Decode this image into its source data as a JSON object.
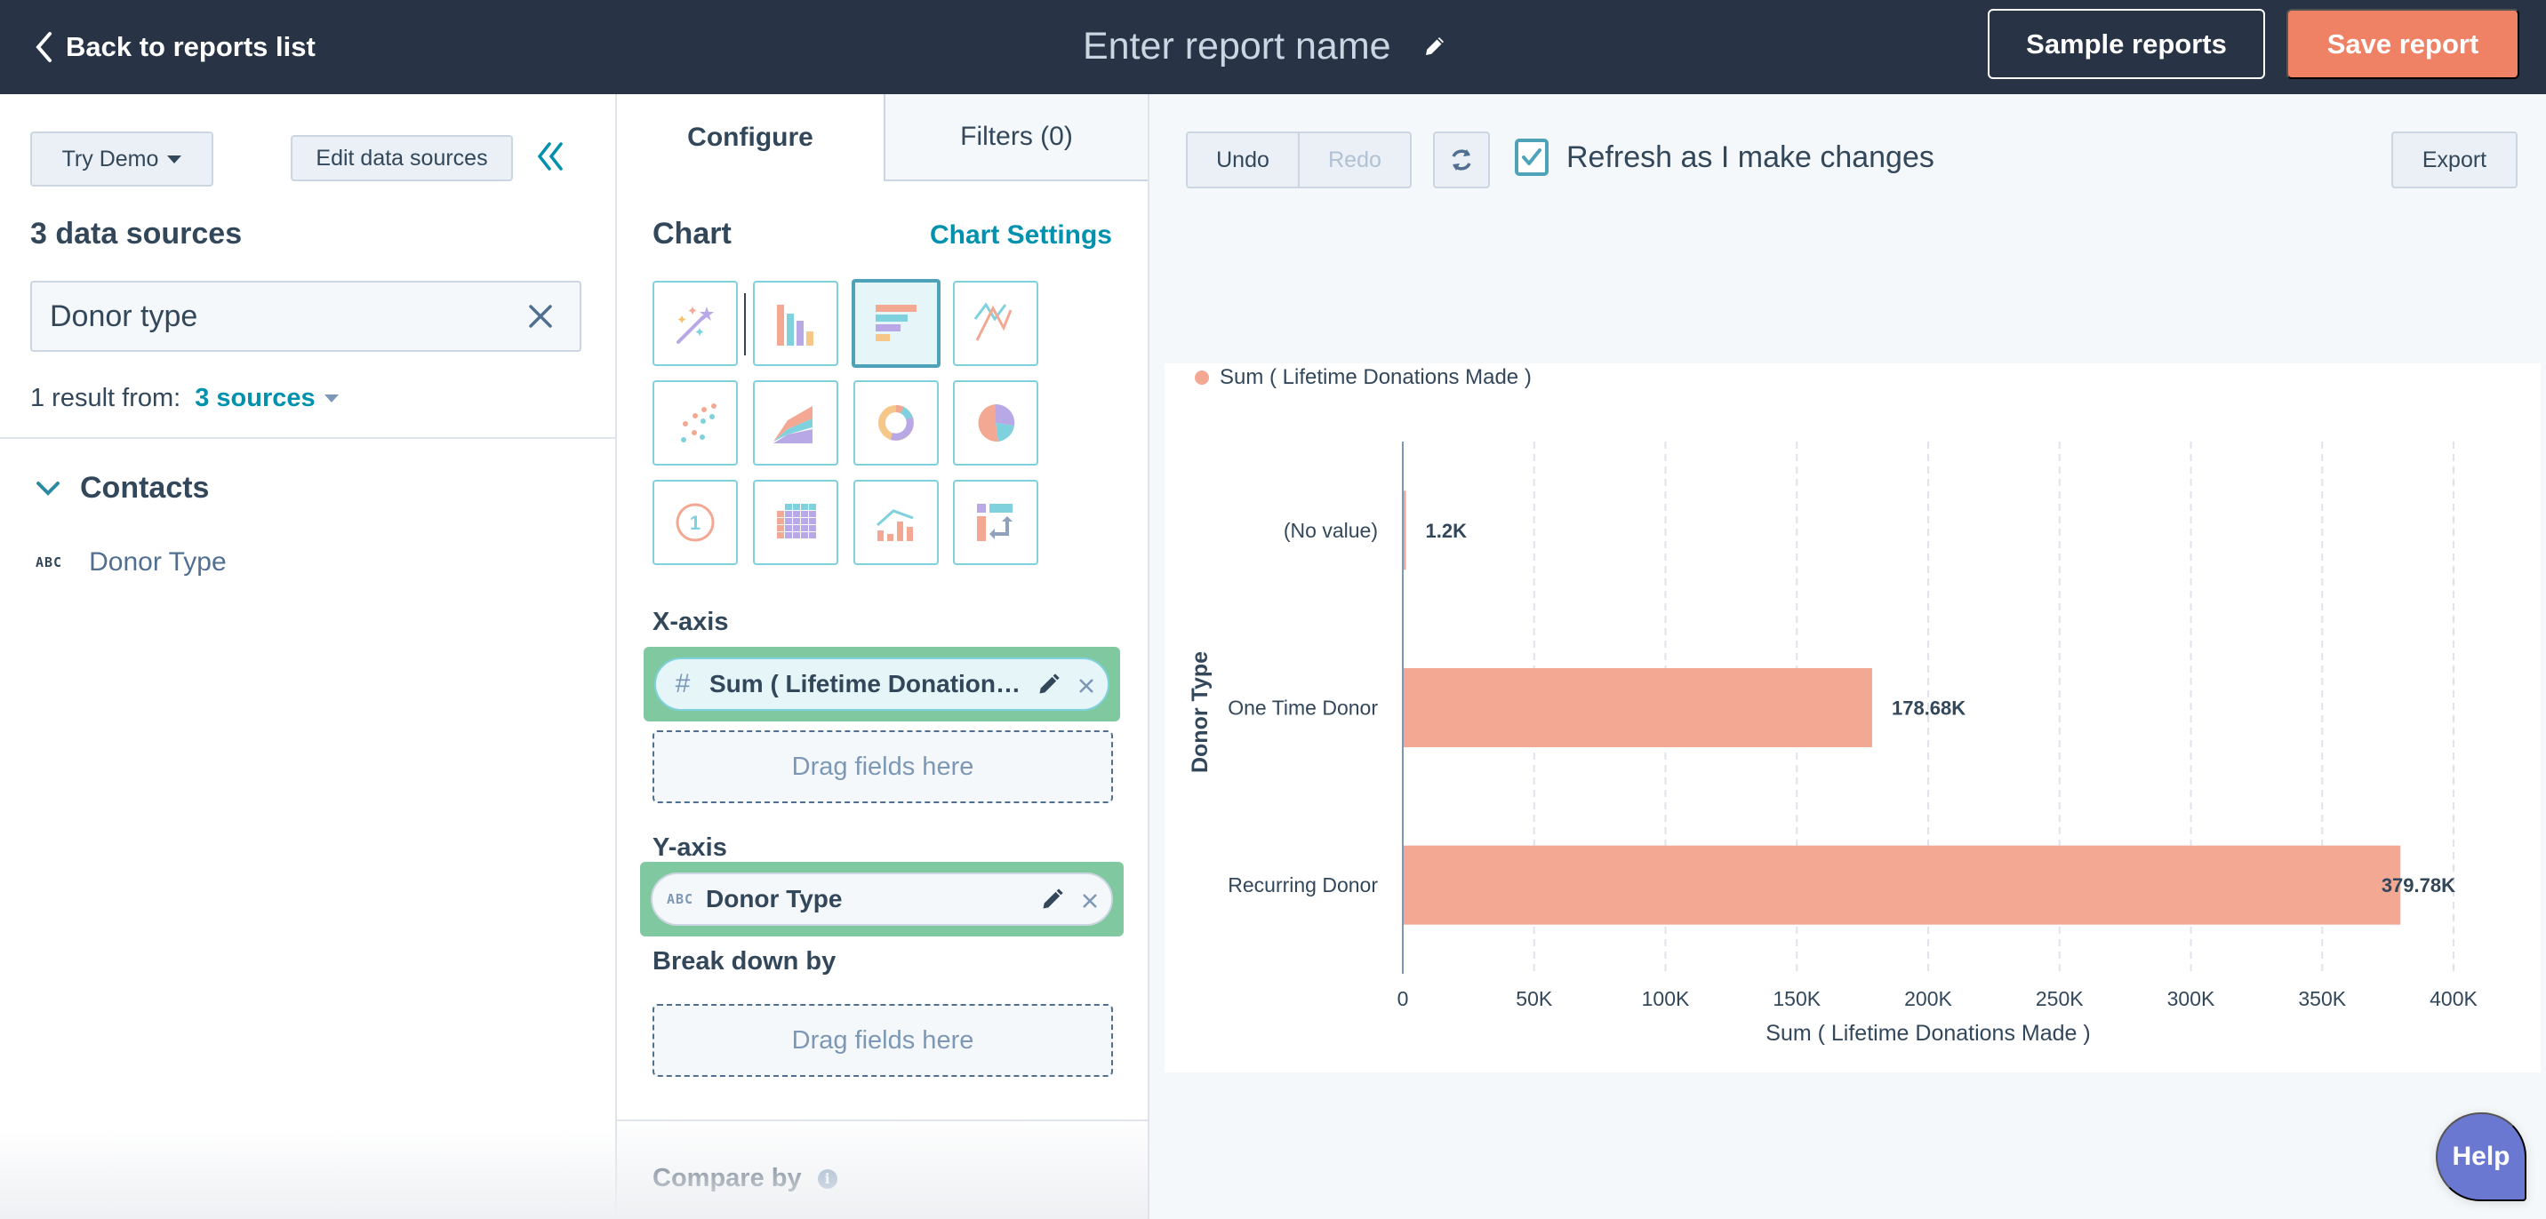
{
  "header": {
    "back_label": "Back to reports list",
    "report_name_placeholder": "Enter report name",
    "sample_reports_label": "Sample reports",
    "save_report_label": "Save report"
  },
  "left_panel": {
    "try_demo_label": "Try Demo",
    "edit_data_sources_label": "Edit data sources",
    "data_sources_title": "3 data sources",
    "search_value": "Donor type",
    "result_prefix": "1 result from:",
    "result_sources_label": "3 sources",
    "groups": [
      {
        "label": "Contacts",
        "expanded": true,
        "fields": [
          {
            "type_icon": "ABC",
            "label": "Donor Type"
          }
        ]
      }
    ]
  },
  "config_panel": {
    "tabs": [
      {
        "label": "Configure",
        "active": true
      },
      {
        "label": "Filters (0)",
        "active": false
      }
    ],
    "chart_heading": "Chart",
    "chart_settings_label": "Chart Settings",
    "chart_types": [
      {
        "name": "auto",
        "icon": "magic-wand-icon",
        "selected": false
      },
      {
        "name": "vertical-bar",
        "icon": "vertical-bar-icon",
        "selected": false
      },
      {
        "name": "horizontal-bar",
        "icon": "horizontal-bar-icon",
        "selected": true
      },
      {
        "name": "line",
        "icon": "line-chart-icon",
        "selected": false
      },
      {
        "name": "scatter",
        "icon": "scatter-icon",
        "selected": false
      },
      {
        "name": "area",
        "icon": "area-chart-icon",
        "selected": false
      },
      {
        "name": "donut",
        "icon": "donut-chart-icon",
        "selected": false
      },
      {
        "name": "pie",
        "icon": "pie-chart-icon",
        "selected": false
      },
      {
        "name": "summary",
        "icon": "summary-number-icon",
        "selected": false
      },
      {
        "name": "pivot-table",
        "icon": "pivot-table-icon",
        "selected": false
      },
      {
        "name": "combo",
        "icon": "combo-chart-icon",
        "selected": false
      },
      {
        "name": "pivot",
        "icon": "pivot-icon",
        "selected": false
      }
    ],
    "x_axis_label": "X-axis",
    "x_axis_field": {
      "type_icon": "#",
      "label": "Sum ( Lifetime Donations ..."
    },
    "drag_placeholder": "Drag fields here",
    "y_axis_label": "Y-axis",
    "y_axis_field": {
      "type_icon": "ABC",
      "label": "Donor Type"
    },
    "break_down_label": "Break down by",
    "compare_by_label": "Compare by",
    "info_glyph": "i"
  },
  "toolbar": {
    "undo_label": "Undo",
    "redo_label": "Redo",
    "auto_refresh_label": "Refresh as I make changes",
    "auto_refresh_checked": true,
    "export_label": "Export"
  },
  "help_label": "Help",
  "colors": {
    "header_bg": "#283445",
    "save_button": "#ef8164",
    "accent": "#0091ae",
    "bar": "#f2a893",
    "highlight": "#7fc8a0",
    "help": "#6a78d1"
  },
  "chart_data": {
    "type": "bar",
    "orientation": "horizontal",
    "legend": [
      {
        "name": "Sum ( Lifetime Donations Made )",
        "color": "#f2a893"
      }
    ],
    "legend_position": "top-left",
    "categories": [
      "(No value)",
      "One Time Donor",
      "Recurring Donor"
    ],
    "series": [
      {
        "name": "Sum ( Lifetime Donations Made )",
        "values": [
          1200,
          178680,
          379780
        ]
      }
    ],
    "data_labels": [
      "1.2K",
      "178.68K",
      "379.78K"
    ],
    "xlabel": "Sum ( Lifetime Donations Made )",
    "ylabel": "Donor Type",
    "xlim": [
      0,
      400000
    ],
    "xticks": [
      0,
      50000,
      100000,
      150000,
      200000,
      250000,
      300000,
      350000,
      400000
    ],
    "xtick_labels": [
      "0",
      "50K",
      "100K",
      "150K",
      "200K",
      "250K",
      "300K",
      "350K",
      "400K"
    ],
    "grid": true
  }
}
